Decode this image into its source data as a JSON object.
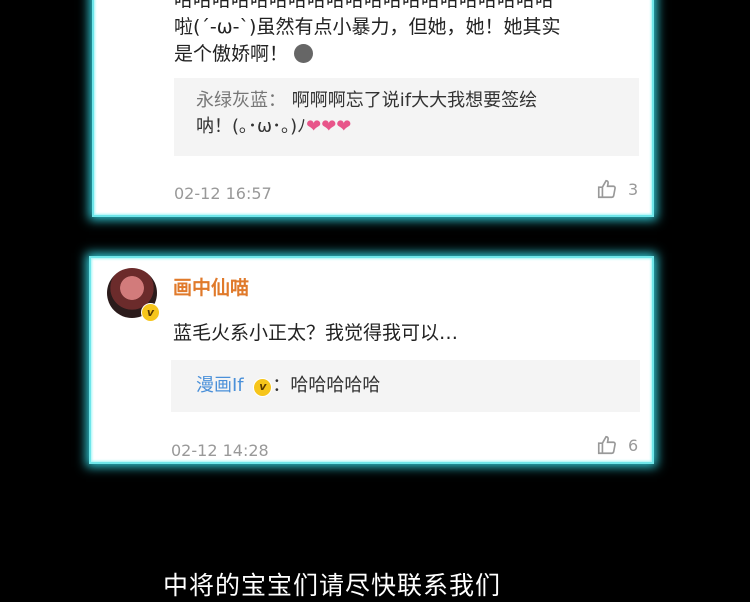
{
  "comment1": {
    "text_line1": "哈哈哈哈哈哈哈哈哈哈哈哈哈哈哈哈哈哈哈哈",
    "text_line2": "啦(´-ω-`)虽然有点小暴力，但她，她！她其实",
    "text_line3": "是个傲娇啊！",
    "reply": {
      "name": "永绿灰蓝：",
      "text1": "啊啊啊忘了说if大大我想要签绘",
      "text2": "呐！(｡･ω･｡)ﾉ"
    },
    "timestamp": "02-12 16:57",
    "likes": "3"
  },
  "comment2": {
    "username": "画中仙喵",
    "text": "蓝毛火系小正太？我觉得我可以…",
    "reply": {
      "name": "漫画If",
      "text": "：哈哈哈哈哈"
    },
    "timestamp": "02-12 14:28",
    "likes": "6"
  },
  "footer_text": "中将的宝宝们请尽快联系我们"
}
